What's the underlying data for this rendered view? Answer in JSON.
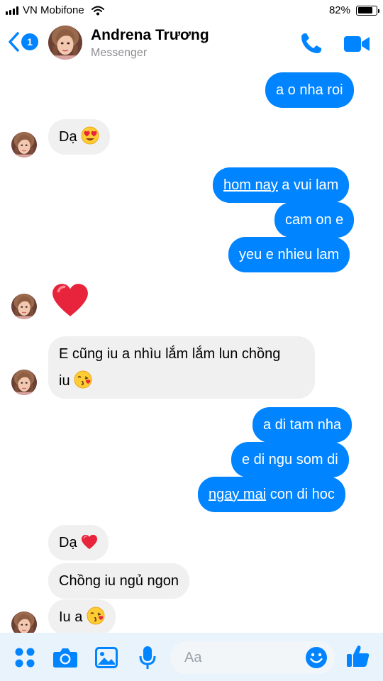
{
  "status_bar": {
    "carrier": "VN Mobifone",
    "battery": "82%",
    "battery_level": 0.82
  },
  "header": {
    "back_badge": "1",
    "contact_name": "Andrena Trương",
    "subtitle": "Messenger"
  },
  "messages": [
    {
      "from": "me",
      "text": "a o nha roi"
    },
    {
      "from": "them",
      "text": "Dạ",
      "emoji": "heart-eyes-emoji"
    },
    {
      "from": "me",
      "underlined": "hom nay",
      "rest": " a vui lam"
    },
    {
      "from": "me",
      "text": "cam on e"
    },
    {
      "from": "me",
      "text": "yeu e nhieu lam"
    },
    {
      "from": "them",
      "emoji": "red-heart-emoji"
    },
    {
      "from": "them",
      "line1": "E cũng iu a nhìu lắm lắm lun chồng",
      "line2": "iu",
      "emoji": "kissing-face-emoji"
    },
    {
      "from": "me",
      "text": "a di tam nha"
    },
    {
      "from": "me",
      "text": "e di ngu som di"
    },
    {
      "from": "me",
      "underlined": "ngay mai",
      "rest": " con di hoc"
    },
    {
      "from": "them",
      "text": "Dạ",
      "emoji": "red-heart-emoji"
    },
    {
      "from": "them",
      "text": "Chồng iu ngủ ngon"
    },
    {
      "from": "them",
      "text": "Iu a",
      "emoji": "kissing-face-emoji"
    }
  ],
  "composer": {
    "placeholder": "Aa"
  },
  "colors": {
    "accent": "#0084ff",
    "incoming_bubble": "#f1f0f0",
    "composer_bg": "#e9f3fb"
  }
}
